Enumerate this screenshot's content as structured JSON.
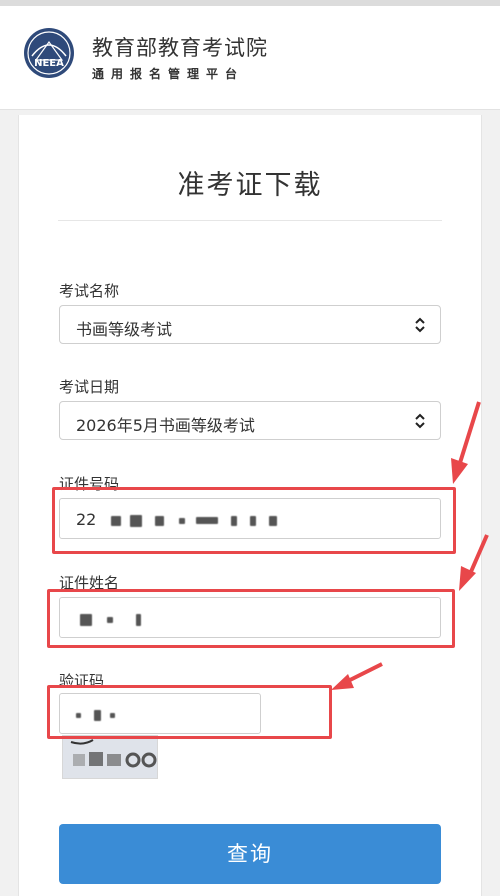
{
  "header": {
    "org_name": "教育部教育考试院",
    "org_subtitle": "通用报名管理平台",
    "logo_text": "NEEA"
  },
  "page": {
    "title": "准考证下载"
  },
  "form": {
    "exam_name": {
      "label": "考试名称",
      "value": "书画等级考试"
    },
    "exam_date": {
      "label": "考试日期",
      "value": "2026年5月书画等级考试"
    },
    "id_number": {
      "label": "证件号码",
      "value_prefix": "22"
    },
    "id_name": {
      "label": "证件姓名"
    },
    "captcha": {
      "label": "验证码"
    },
    "submit_label": "查询"
  },
  "colors": {
    "accent": "#3a8cd6",
    "annotation": "#e8474a"
  }
}
